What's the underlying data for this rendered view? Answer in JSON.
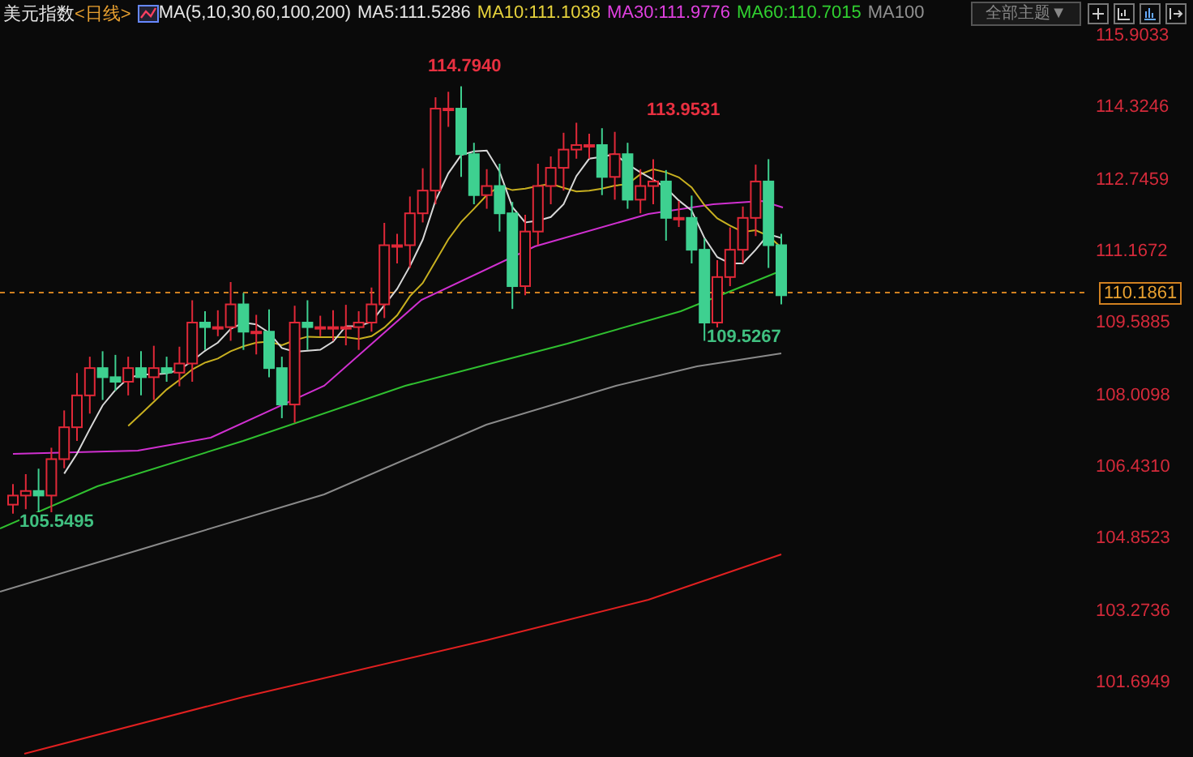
{
  "header": {
    "title": "美元指数",
    "period": "<日线>",
    "indicator": "MA(5,10,30,60,100,200)",
    "legend": [
      {
        "label": "MA5:111.5286",
        "color": "#e6e6e6"
      },
      {
        "label": "MA10:111.1038",
        "color": "#e6d23c"
      },
      {
        "label": "MA30:111.9776",
        "color": "#e040e0"
      },
      {
        "label": "MA60:110.7015",
        "color": "#30d030"
      },
      {
        "label": "MA100",
        "color": "#909090"
      }
    ],
    "theme_dropdown": "全部主题▼"
  },
  "y_axis": {
    "labels": [
      "115.9033",
      "114.3246",
      "112.7459",
      "111.1672",
      "109.5885",
      "108.0098",
      "106.4310",
      "104.8523",
      "103.2736",
      "101.6949"
    ]
  },
  "current_price": "110.1861",
  "annotations": [
    {
      "text": "114.7940",
      "kind": "high"
    },
    {
      "text": "113.9531",
      "kind": "high"
    },
    {
      "text": "109.5267",
      "kind": "low"
    },
    {
      "text": "105.5495",
      "kind": "low"
    }
  ]
}
